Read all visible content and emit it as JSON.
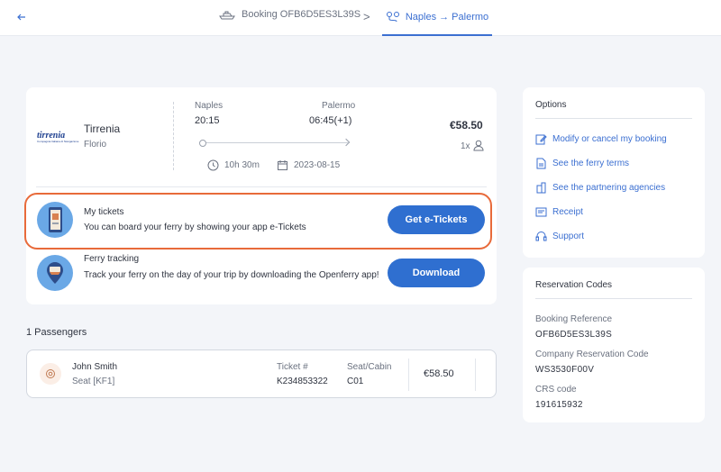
{
  "header": {
    "back_icon": "arrow-left-icon",
    "booking_label": "Booking OFB6D5ES3L39S",
    "separator": ">",
    "route_label": "Naples → Palermo"
  },
  "trip": {
    "company": "Tirrenia",
    "vessel": "Florio",
    "logo_text": "tirrenia",
    "logo_tagline": "Compagnia Italiana di Navigazione",
    "origin": "Naples",
    "destination": "Palermo",
    "depart_time": "20:15",
    "arrive_time": "06:45(+1)",
    "duration": "10h 30m",
    "date": "2023-08-15",
    "price": "€58.50",
    "passenger_count": "1x"
  },
  "tickets": {
    "title": "My tickets",
    "description": "You can board your ferry by showing your app e-Tickets",
    "button": "Get e-Tickets"
  },
  "tracking": {
    "title": "Ferry tracking",
    "description": "Track your ferry on the day of your trip by downloading the Openferry app!",
    "button": "Download"
  },
  "passengers": {
    "heading": "1 Passengers",
    "list": [
      {
        "name": "John Smith",
        "seat": "Seat [KF1]",
        "ticket_label": "Ticket #",
        "ticket_number": "K234853322",
        "seat_label": "Seat/Cabin",
        "seat_value": "C01",
        "price": "€58.50"
      }
    ]
  },
  "options": {
    "title": "Options",
    "items": [
      {
        "label": "Modify or cancel my booking",
        "icon": "edit-icon"
      },
      {
        "label": "See the ferry terms",
        "icon": "document-icon"
      },
      {
        "label": "See the partnering agencies",
        "icon": "building-icon"
      },
      {
        "label": "Receipt",
        "icon": "receipt-icon"
      },
      {
        "label": "Support",
        "icon": "headset-icon"
      }
    ]
  },
  "codes": {
    "title": "Reservation Codes",
    "booking_ref_label": "Booking Reference",
    "booking_ref": "OFB6D5ES3L39S",
    "company_code_label": "Company Reservation Code",
    "company_code": "WS3530F00V",
    "crs_label": "CRS code",
    "crs": "191615932"
  },
  "colors": {
    "accent": "#2f6fd0",
    "link": "#3b6fd1",
    "highlight": "#e86a3a",
    "background": "#f3f5f9"
  }
}
